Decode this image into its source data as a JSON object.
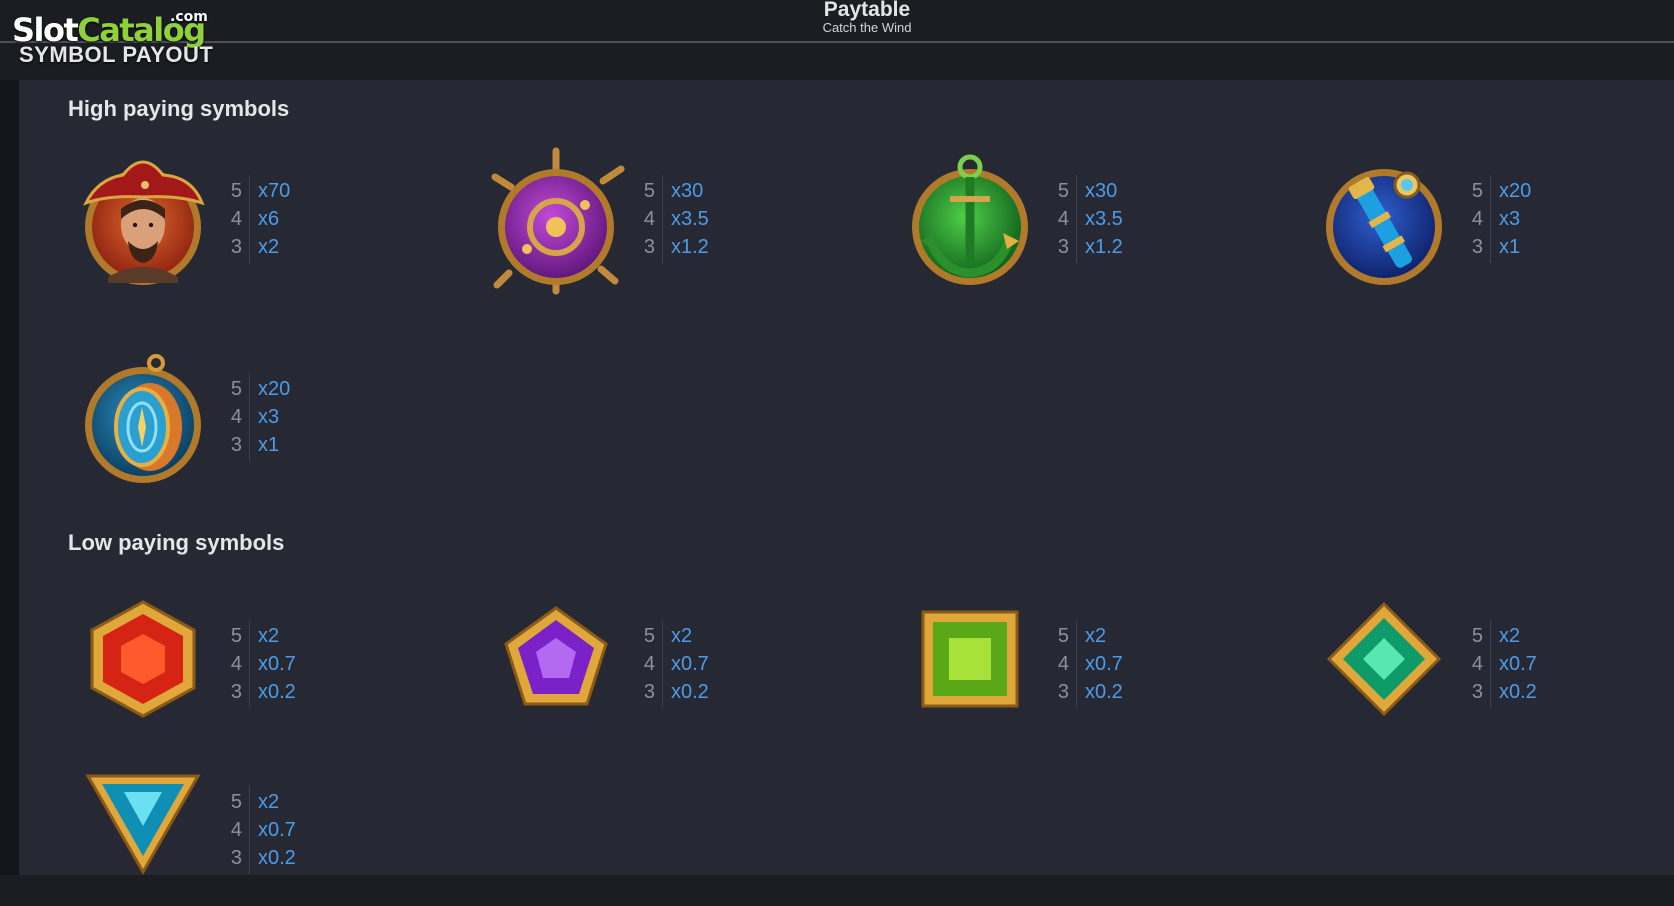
{
  "watermark": {
    "text_main": "Slot",
    "text_accent": "Catalog",
    "text_suffix": ".com"
  },
  "header": {
    "title": "Paytable",
    "subtitle": "Catch the Wind"
  },
  "section_title": "SYMBOL PAYOUT",
  "colors": {
    "background": "#1b1d23",
    "panel": "#262934",
    "payout_value": "#4d9be6",
    "payout_count": "#8d909a",
    "heading": "#e6e6e8"
  },
  "high": {
    "heading": "High paying symbols",
    "symbols": [
      {
        "icon": "pirate-captain-icon",
        "pays": [
          {
            "count": "5",
            "value": "x70"
          },
          {
            "count": "4",
            "value": "x6"
          },
          {
            "count": "3",
            "value": "x2"
          }
        ]
      },
      {
        "icon": "ship-wheel-icon",
        "pays": [
          {
            "count": "5",
            "value": "x30"
          },
          {
            "count": "4",
            "value": "x3.5"
          },
          {
            "count": "3",
            "value": "x1.2"
          }
        ]
      },
      {
        "icon": "anchor-icon",
        "pays": [
          {
            "count": "5",
            "value": "x30"
          },
          {
            "count": "4",
            "value": "x3.5"
          },
          {
            "count": "3",
            "value": "x1.2"
          }
        ]
      },
      {
        "icon": "spyglass-icon",
        "pays": [
          {
            "count": "5",
            "value": "x20"
          },
          {
            "count": "4",
            "value": "x3"
          },
          {
            "count": "3",
            "value": "x1"
          }
        ]
      },
      {
        "icon": "compass-icon",
        "pays": [
          {
            "count": "5",
            "value": "x20"
          },
          {
            "count": "4",
            "value": "x3"
          },
          {
            "count": "3",
            "value": "x1"
          }
        ]
      }
    ]
  },
  "low": {
    "heading": "Low paying symbols",
    "symbols": [
      {
        "icon": "red-hexagon-gem-icon",
        "pays": [
          {
            "count": "5",
            "value": "x2"
          },
          {
            "count": "4",
            "value": "x0.7"
          },
          {
            "count": "3",
            "value": "x0.2"
          }
        ]
      },
      {
        "icon": "purple-pentagon-gem-icon",
        "pays": [
          {
            "count": "5",
            "value": "x2"
          },
          {
            "count": "4",
            "value": "x0.7"
          },
          {
            "count": "3",
            "value": "x0.2"
          }
        ]
      },
      {
        "icon": "green-square-gem-icon",
        "pays": [
          {
            "count": "5",
            "value": "x2"
          },
          {
            "count": "4",
            "value": "x0.7"
          },
          {
            "count": "3",
            "value": "x0.2"
          }
        ]
      },
      {
        "icon": "teal-diamond-gem-icon",
        "pays": [
          {
            "count": "5",
            "value": "x2"
          },
          {
            "count": "4",
            "value": "x0.7"
          },
          {
            "count": "3",
            "value": "x0.2"
          }
        ]
      },
      {
        "icon": "blue-triangle-gem-icon",
        "pays": [
          {
            "count": "5",
            "value": "x2"
          },
          {
            "count": "4",
            "value": "x0.7"
          },
          {
            "count": "3",
            "value": "x0.2"
          }
        ]
      }
    ]
  }
}
